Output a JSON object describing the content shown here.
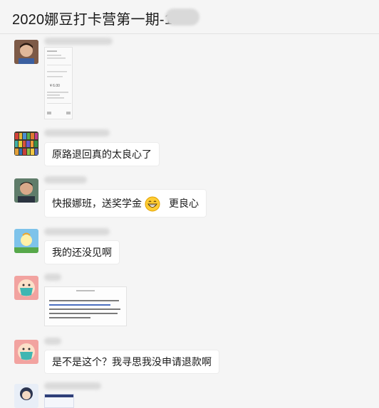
{
  "header": {
    "title": "2020娜豆打卡营第一期-1"
  },
  "messages": [
    {
      "type": "image"
    },
    {
      "type": "text",
      "text": "原路退回真的太良心了"
    },
    {
      "type": "text",
      "text_before": "快报娜班，送奖学金",
      "emoji": "grinning-emoji",
      "text_after": "更良心"
    },
    {
      "type": "text",
      "text": "我的还没见啊"
    },
    {
      "type": "image"
    },
    {
      "type": "text",
      "text": "是不是这个？我寻思我没申请退款啊"
    },
    {
      "type": "image"
    }
  ],
  "image_texts": {
    "receipt_amount": "¥ 6.00"
  }
}
